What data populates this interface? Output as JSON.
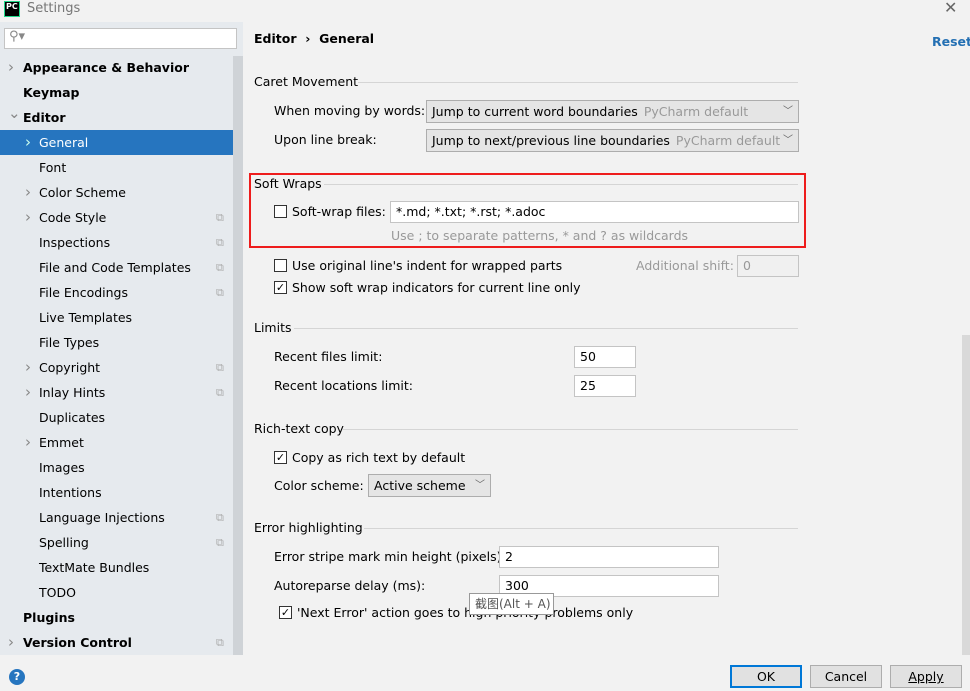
{
  "window": {
    "title": "Settings",
    "logo": "PC",
    "close_icon": "close-icon"
  },
  "sidebar": {
    "search_placeholder": "",
    "items": [
      {
        "label": "Appearance & Behavior",
        "level": 0,
        "bold": true,
        "expandable": "collapsed"
      },
      {
        "label": "Keymap",
        "level": 0,
        "bold": true
      },
      {
        "label": "Editor",
        "level": 0,
        "bold": true,
        "expandable": "expanded"
      },
      {
        "label": "General",
        "level": 1,
        "selected": true,
        "expandable": "collapsed"
      },
      {
        "label": "Font",
        "level": 1
      },
      {
        "label": "Color Scheme",
        "level": 1,
        "expandable": "collapsed"
      },
      {
        "label": "Code Style",
        "level": 1,
        "expandable": "collapsed",
        "project_icon": true
      },
      {
        "label": "Inspections",
        "level": 1,
        "project_icon": true
      },
      {
        "label": "File and Code Templates",
        "level": 1,
        "project_icon": true
      },
      {
        "label": "File Encodings",
        "level": 1,
        "project_icon": true
      },
      {
        "label": "Live Templates",
        "level": 1
      },
      {
        "label": "File Types",
        "level": 1
      },
      {
        "label": "Copyright",
        "level": 1,
        "expandable": "collapsed",
        "project_icon": true
      },
      {
        "label": "Inlay Hints",
        "level": 1,
        "expandable": "collapsed",
        "project_icon": true
      },
      {
        "label": "Duplicates",
        "level": 1
      },
      {
        "label": "Emmet",
        "level": 1,
        "expandable": "collapsed"
      },
      {
        "label": "Images",
        "level": 1
      },
      {
        "label": "Intentions",
        "level": 1
      },
      {
        "label": "Language Injections",
        "level": 1,
        "project_icon": true
      },
      {
        "label": "Spelling",
        "level": 1,
        "project_icon": true
      },
      {
        "label": "TextMate Bundles",
        "level": 1
      },
      {
        "label": "TODO",
        "level": 1
      },
      {
        "label": "Plugins",
        "level": 0,
        "bold": true
      },
      {
        "label": "Version Control",
        "level": 0,
        "bold": true,
        "expandable": "collapsed",
        "project_icon": true
      }
    ]
  },
  "header": {
    "breadcrumb": [
      "Editor",
      "General"
    ],
    "separator": "›",
    "reset": "Reset"
  },
  "caret": {
    "title": "Caret Movement",
    "words_label": "When moving by words:",
    "words_value": "Jump to current word boundaries",
    "words_hint": "PyCharm default",
    "linebreak_label": "Upon line break:",
    "linebreak_value": "Jump to next/previous line boundaries",
    "linebreak_hint": "PyCharm default"
  },
  "softwraps": {
    "title": "Soft Wraps",
    "files_label": "Soft-wrap files:",
    "files_checked": false,
    "files_value": "*.md; *.txt; *.rst; *.adoc",
    "files_hint": "Use ; to separate patterns, * and ? as wildcards",
    "indent_label": "Use original line's indent for wrapped parts",
    "indent_checked": false,
    "shift_label": "Additional shift:",
    "shift_value": "0",
    "indicators_label": "Show soft wrap indicators for current line only",
    "indicators_checked": true
  },
  "limits": {
    "title": "Limits",
    "files_label": "Recent files limit:",
    "files_value": "50",
    "locations_label": "Recent locations limit:",
    "locations_value": "25"
  },
  "richtext": {
    "title": "Rich-text copy",
    "copy_label": "Copy as rich text by default",
    "copy_checked": true,
    "scheme_label": "Color scheme:",
    "scheme_value": "Active scheme"
  },
  "errors": {
    "title": "Error highlighting",
    "stripe_label": "Error stripe mark min height (pixels):",
    "stripe_value": "2",
    "delay_label": "Autoreparse delay (ms):",
    "delay_value": "300",
    "next_label": "'Next Error' action goes to high priority problems only",
    "next_checked": true
  },
  "tooltip": "截图(Alt + A)",
  "footer": {
    "ok": "OK",
    "cancel": "Cancel",
    "apply": "Apply",
    "help": "?"
  },
  "colors": {
    "accent": "#2675bf",
    "highlight_box": "#ee1c1c"
  }
}
